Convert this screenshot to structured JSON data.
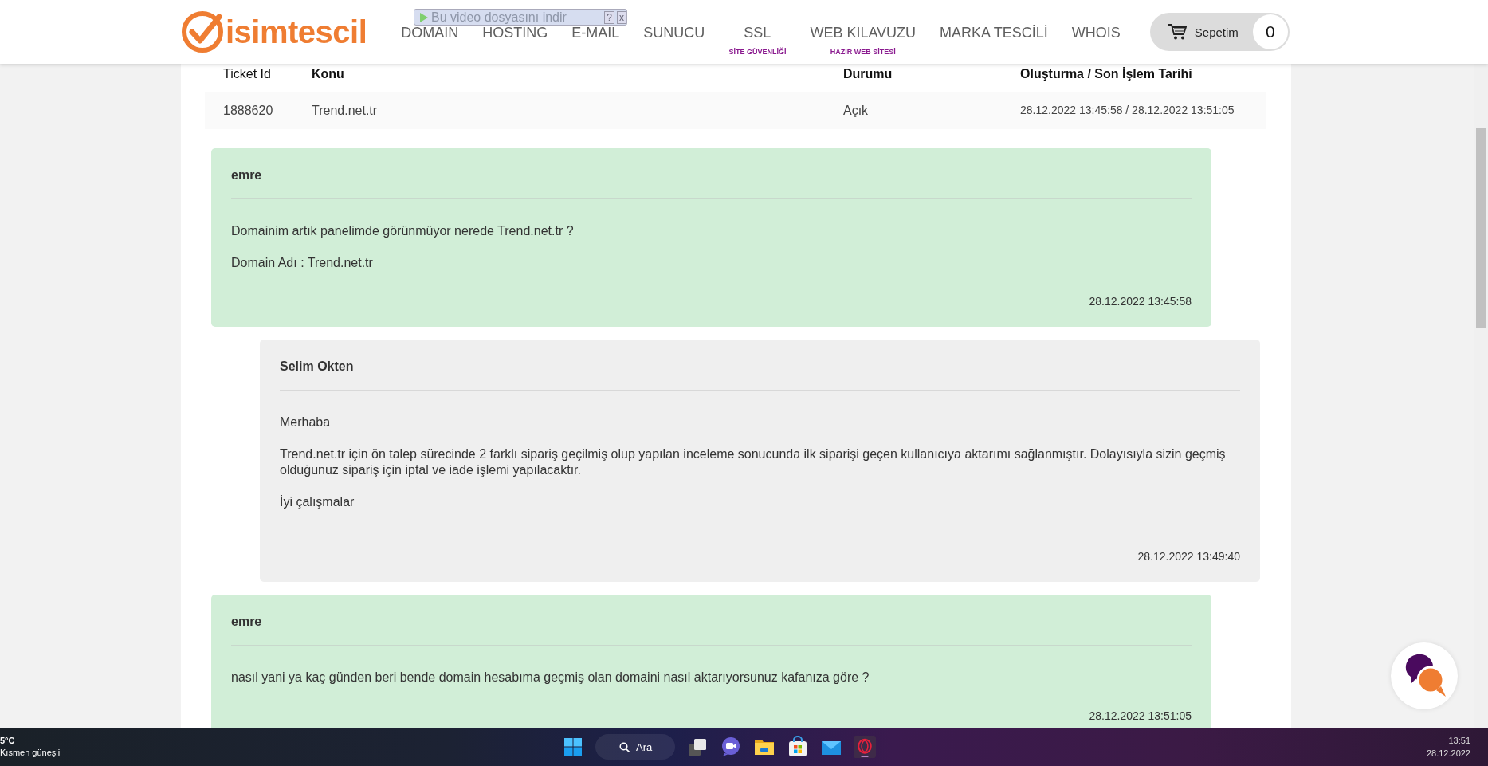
{
  "header": {
    "logo": "isimtescil",
    "nav": [
      {
        "label": "DOMAIN"
      },
      {
        "label": "HOSTING"
      },
      {
        "label": "E-MAIL"
      },
      {
        "label": "SUNUCU"
      },
      {
        "label": "SSL",
        "sublabel": "SİTE GÜVENLİĞİ"
      },
      {
        "label": "WEB KILAVUZU",
        "sublabel": "HAZIR WEB SİTESİ"
      },
      {
        "label": "MARKA TESCİLİ"
      },
      {
        "label": "WHOIS"
      }
    ],
    "cart": {
      "label": "Sepetim",
      "count": "0"
    },
    "video_overlay": {
      "label": "Bu video dosyasını indir",
      "help": "?",
      "close": "x"
    }
  },
  "ticket_table": {
    "columns": [
      "Ticket Id",
      "Konu",
      "Durumu",
      "Oluşturma / Son İşlem Tarihi"
    ],
    "rows": [
      [
        "1888620",
        "Trend.net.tr",
        "Açık",
        "28.12.2022 13:45:58 / 28.12.2022 13:51:05"
      ]
    ]
  },
  "messages": [
    {
      "kind": "customer",
      "author": "emre",
      "paragraphs": [
        "Domainim artık panelimde görünmüyor nerede Trend.net.tr ?",
        "Domain Adı : Trend.net.tr"
      ],
      "time": "28.12.2022 13:45:58"
    },
    {
      "kind": "staff",
      "author": "Selim Okten",
      "paragraphs": [
        "Merhaba",
        "Trend.net.tr için ön talep sürecinde 2 farklı sipariş geçilmiş olup yapılan inceleme sonucunda ilk siparişi geçen kullanıcıya aktarımı sağlanmıştır. Dolayısıyla sizin geçmiş olduğunuz sipariş için iptal ve iade işlemi yapılacaktır.",
        "İyi çalışmalar"
      ],
      "time": "28.12.2022 13:49:40"
    },
    {
      "kind": "customer",
      "author": "emre",
      "paragraphs": [
        "nasıl yani ya kaç günden beri bende domain hesabıma geçmiş olan domaini nasıl aktarıyorsunuz kafanıza göre ?"
      ],
      "time": "28.12.2022 13:51:05"
    }
  ],
  "taskbar": {
    "weather": {
      "temperature": "5°C",
      "condition": "Kısmen güneşli"
    },
    "search": "Ara",
    "clock": {
      "time": "13:51",
      "date": "28.12.2022"
    }
  }
}
